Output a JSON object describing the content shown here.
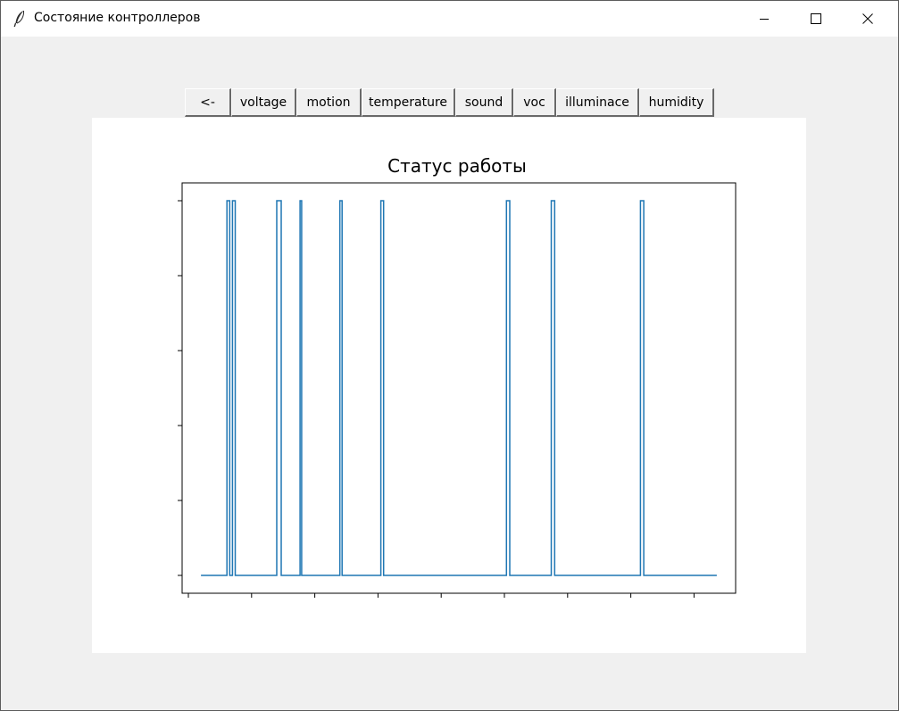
{
  "window": {
    "title": "Состояние контроллеров",
    "icon": "feather-icon",
    "controls": [
      "minimize-icon",
      "maximize-icon",
      "close-icon"
    ]
  },
  "toolbar": {
    "buttons": [
      {
        "label": "<-"
      },
      {
        "label": "voltage"
      },
      {
        "label": "motion"
      },
      {
        "label": "temperature"
      },
      {
        "label": "sound"
      },
      {
        "label": "voc"
      },
      {
        "label": "illuminace"
      },
      {
        "label": "humidity"
      }
    ]
  },
  "chart_data": {
    "type": "line",
    "title": "Статус работы",
    "xlabel": "",
    "ylabel": "",
    "grid": false,
    "line_color": "#1f77b4",
    "x_tick_count": 9,
    "y_tick_count": 6,
    "ylim": [
      0,
      1
    ],
    "xlim": [
      0,
      1
    ],
    "series": [
      {
        "x": [
          0.034,
          0.081,
          0.081,
          0.086,
          0.086,
          0.091,
          0.091,
          0.096,
          0.096,
          0.171,
          0.171,
          0.179,
          0.179,
          0.213,
          0.213,
          0.216,
          0.216,
          0.285,
          0.285,
          0.289,
          0.289,
          0.359,
          0.359,
          0.364,
          0.364,
          0.586,
          0.586,
          0.592,
          0.592,
          0.667,
          0.667,
          0.673,
          0.673,
          0.828,
          0.828,
          0.834,
          0.834,
          0.966
        ],
        "y": [
          0,
          0,
          1,
          1,
          0,
          0,
          1,
          1,
          0,
          0,
          1,
          1,
          0,
          0,
          1,
          1,
          0,
          0,
          1,
          1,
          0,
          0,
          1,
          1,
          0,
          0,
          1,
          1,
          0,
          0,
          1,
          1,
          0,
          0,
          1,
          1,
          0,
          0
        ]
      }
    ]
  }
}
